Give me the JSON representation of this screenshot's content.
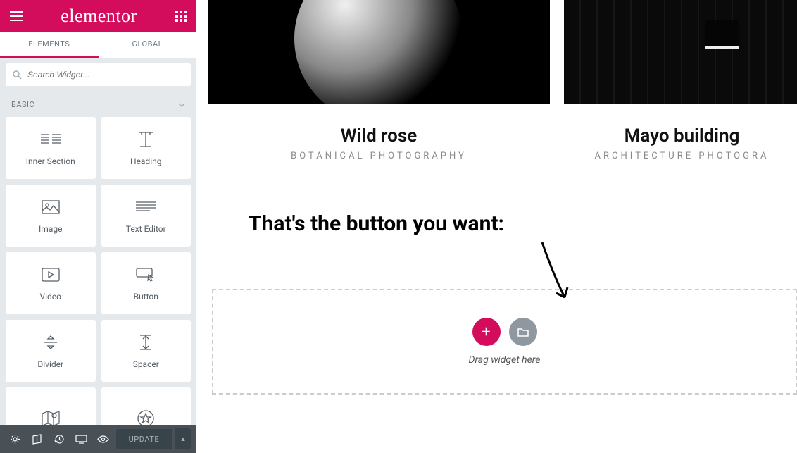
{
  "header": {
    "brand": "elementor"
  },
  "tabs": {
    "elements": "ELEMENTS",
    "global": "GLOBAL"
  },
  "search": {
    "placeholder": "Search Widget..."
  },
  "category": {
    "basic": "BASIC"
  },
  "widgets": {
    "inner_section": "Inner Section",
    "heading": "Heading",
    "image": "Image",
    "text_editor": "Text Editor",
    "video": "Video",
    "button": "Button",
    "divider": "Divider",
    "spacer": "Spacer"
  },
  "footer": {
    "update": "UPDATE"
  },
  "portfolio": {
    "a": {
      "title": "Wild rose",
      "subtitle": "BOTANICAL PHOTOGRAPHY"
    },
    "b": {
      "title": "Mayo building",
      "subtitle": "ARCHITECTURE PHOTOGRA"
    }
  },
  "annotation": "That's the button you want:",
  "dropzone": {
    "hint": "Drag widget here"
  }
}
